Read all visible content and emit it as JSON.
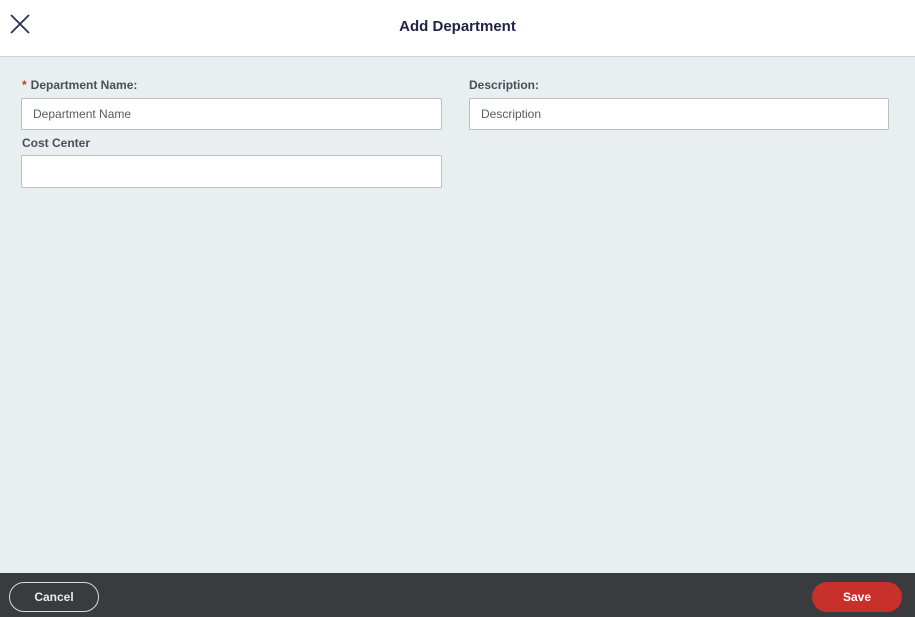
{
  "dialog": {
    "title": "Add Department",
    "close_icon": "close-icon"
  },
  "form": {
    "department_name": {
      "label": "Department Name:",
      "required_marker": "*",
      "placeholder": "Department Name",
      "value": ""
    },
    "description": {
      "label": "Description:",
      "placeholder": "Description",
      "value": ""
    },
    "cost_center": {
      "label": "Cost Center",
      "placeholder": "",
      "value": ""
    }
  },
  "footer": {
    "cancel_label": "Cancel",
    "save_label": "Save"
  },
  "colors": {
    "accent": "#c8312b",
    "footer_bg": "#3a3b3f",
    "content_bg": "#e9eef1",
    "title_text": "#1f2344"
  }
}
